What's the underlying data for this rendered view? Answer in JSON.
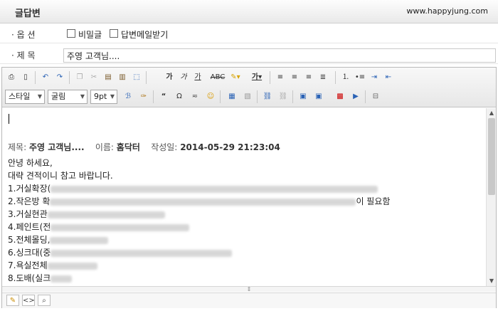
{
  "header": {
    "title": "글답변",
    "site": "www.happyjung.com"
  },
  "options": {
    "label": "· 옵 션",
    "secret_label": "비밀글",
    "reply_mail_label": "답변메일받기"
  },
  "subject": {
    "label": "· 제 목",
    "value": "주영 고객님...."
  },
  "toolbar": {
    "style_select": "스타일",
    "font_select": "굴림",
    "size_select": "9pt"
  },
  "content": {
    "meta_subject_label": "제목:",
    "meta_subject_value": "주영 고객님....",
    "meta_name_label": "이름:",
    "meta_name_value": "홈닥터",
    "meta_date_label": "작성일:",
    "meta_date_value": "2014-05-29 21:23:04",
    "greeting": "안녕 하세요,",
    "intro": "대략 견적이니 참고 바랍니다.",
    "items": [
      {
        "prefix": "1.거실확장(",
        "suffix": ""
      },
      {
        "prefix": "2.작은방 확",
        "suffix": "이 필요함"
      },
      {
        "prefix": "3.거실현관",
        "suffix": ""
      },
      {
        "prefix": "4.페인트(전",
        "suffix": ""
      },
      {
        "prefix": "5.전체몰딩,",
        "suffix": ""
      },
      {
        "prefix": "6.싱크대(중",
        "suffix": ""
      },
      {
        "prefix": "7.욕실전체",
        "suffix": ""
      },
      {
        "prefix": "8.도배(실크",
        "suffix": ""
      }
    ]
  }
}
